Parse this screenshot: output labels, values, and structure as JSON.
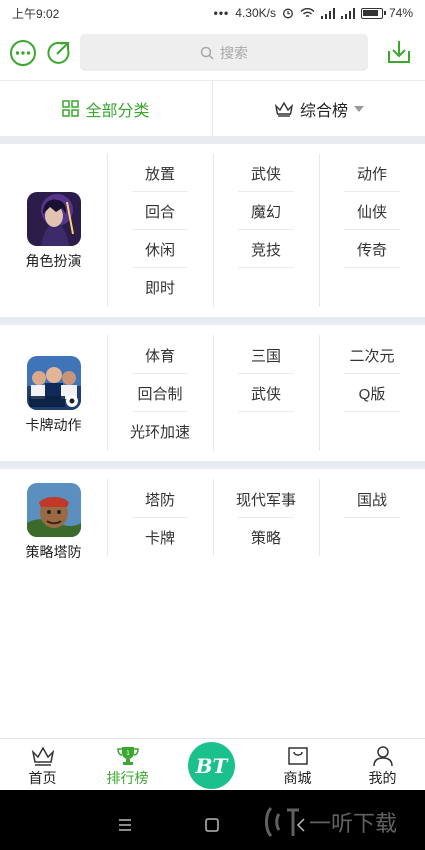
{
  "status_bar": {
    "time": "上午9:02",
    "speed": "4.30K/s",
    "battery": "74%"
  },
  "header": {
    "search_placeholder": "搜索"
  },
  "filter_bar": {
    "all_categories": "全部分类",
    "ranking": "综合榜"
  },
  "sections": [
    {
      "name": "角色扮演",
      "tags": [
        "放置",
        "武侠",
        "动作",
        "回合",
        "魔幻",
        "仙侠",
        "休闲",
        "竞技",
        "传奇",
        "即时"
      ]
    },
    {
      "name": "卡牌动作",
      "tags": [
        "体育",
        "三国",
        "二次元",
        "回合制",
        "武侠",
        "Q版",
        "光环加速"
      ]
    },
    {
      "name": "策略塔防",
      "tags": [
        "塔防",
        "现代军事",
        "国战",
        "卡牌",
        "策略"
      ]
    }
  ],
  "tab_bar": {
    "home": "首页",
    "ranking": "排行榜",
    "bt": "BT",
    "mall": "商城",
    "mine": "我的"
  },
  "watermark": {
    "text": "一听下载"
  },
  "colors": {
    "accent_green": "#3aa72f",
    "bt_green": "#1ac18c",
    "band_gray": "#e8ebef"
  }
}
